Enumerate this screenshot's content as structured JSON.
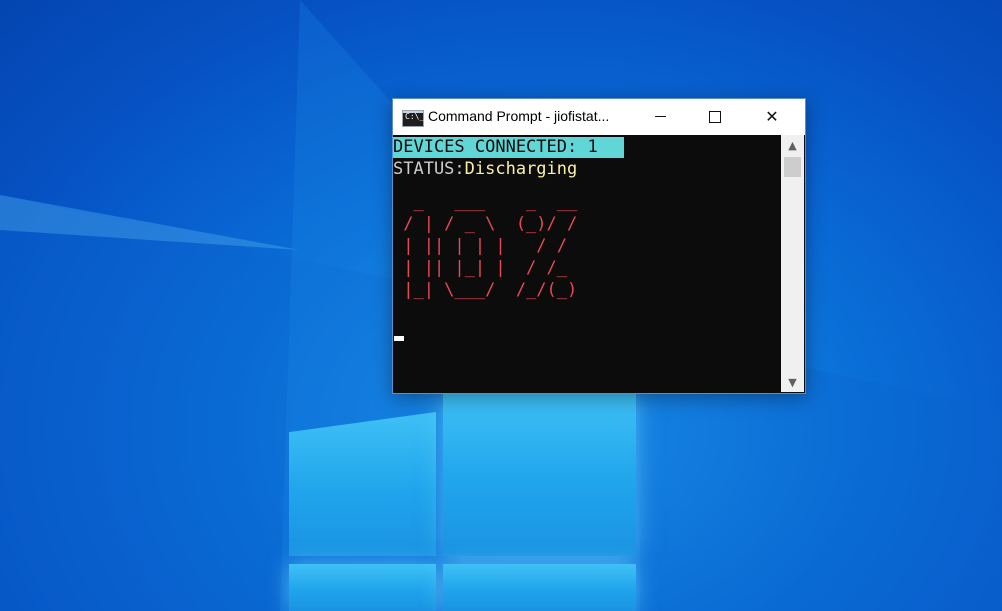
{
  "window": {
    "title": "Command Prompt - jiofistat...",
    "icon_text": "C:\\_",
    "controls": {
      "minimize": "minimize",
      "maximize": "maximize",
      "close": "✕"
    }
  },
  "console": {
    "devices_line": "DEVICES CONNECTED: 1",
    "status_label": "STATUS:",
    "status_value": "Discharging",
    "ascii_percent": "  _   ___    _  __\n / | / _ \\  (_)/ /\n | || | | |   / / \n | || |_| |  / /_ \n |_| \\___/  /_/(_)",
    "battery_percent": "10%"
  },
  "scrollbar": {
    "up_arrow": "▲",
    "down_arrow": "▼"
  },
  "colors": {
    "console_bg": "#0c0c0c",
    "highlight_bg": "#61d6d6",
    "status_value": "#f9f1a5",
    "ascii_red": "#e74856",
    "desktop_blue": "#0a6fd8"
  }
}
